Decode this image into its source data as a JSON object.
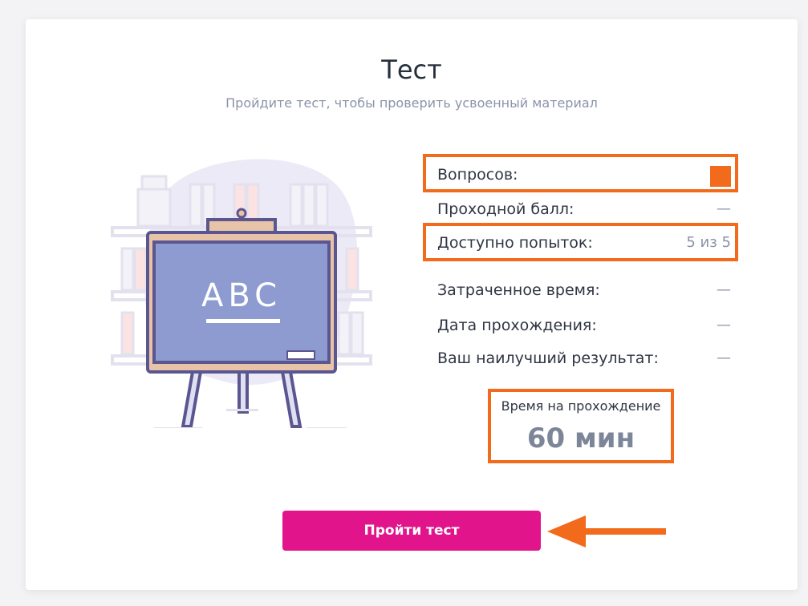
{
  "header": {
    "title": "Тест",
    "subtitle": "Пройдите тест, чтобы проверить усвоенный материал"
  },
  "illustration": {
    "board_text": "ABC",
    "icon": "easel-chalkboard-icon"
  },
  "stats": {
    "questions": {
      "label": "Вопросов:",
      "value": ""
    },
    "passing_score": {
      "label": "Проходной балл:",
      "value": "—"
    },
    "attempts": {
      "label": "Доступно попыток:",
      "value": "5 из 5"
    },
    "time_spent": {
      "label": "Затраченное время:",
      "value": "—"
    },
    "date": {
      "label": "Дата прохождения:",
      "value": "—"
    },
    "best": {
      "label": "Ваш наилучший результат:",
      "value": "—"
    }
  },
  "time_limit": {
    "label": "Время на прохождение",
    "value": "60 мин"
  },
  "start_button": {
    "label": "Пройти тест"
  },
  "colors": {
    "accent": "#e2148b",
    "highlight": "#f26a1b",
    "text_muted": "#8b93a6"
  }
}
